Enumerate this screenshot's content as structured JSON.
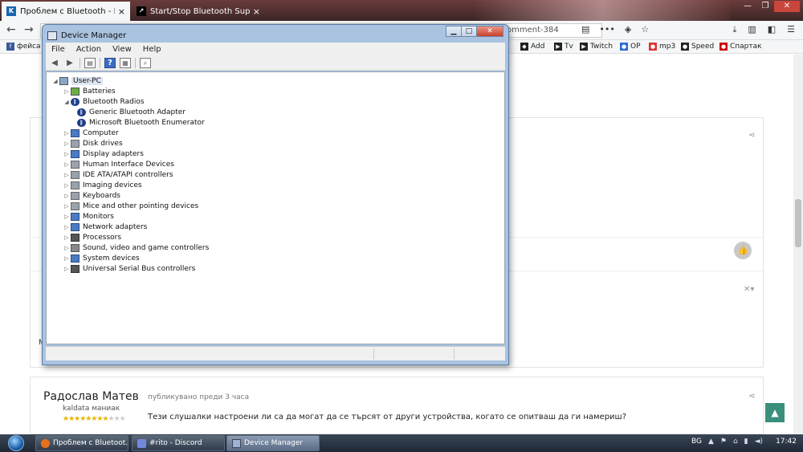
{
  "browser": {
    "tabs": [
      {
        "title": "Проблем с Bluetooth - Програ",
        "favicon": "K",
        "active": true
      },
      {
        "title": "Start/Stop Bluetooth Support se",
        "favicon": "↗",
        "active": false
      }
    ],
    "url_suffix": "omment-384",
    "bookmarks": [
      {
        "label": "фейса",
        "icon": "f",
        "color": "#3b5998"
      },
      {
        "label": "Add",
        "icon": "◆",
        "color": "#222"
      },
      {
        "label": "Tv",
        "icon": "▶",
        "color": "#222"
      },
      {
        "label": "Twitch",
        "icon": "▶",
        "color": "#222"
      },
      {
        "label": "OP",
        "icon": "●",
        "color": "#2b6cd3"
      },
      {
        "label": "mp3",
        "icon": "●",
        "color": "#d33"
      },
      {
        "label": "Speed",
        "icon": "●",
        "color": "#222"
      },
      {
        "label": "Спартак",
        "icon": "●",
        "color": "#c00"
      }
    ]
  },
  "page": {
    "left_letter": "M",
    "post": {
      "author": "Радослав Матев",
      "meta": "публикувано преди 3 часа",
      "rank": "kaldata маниак",
      "stars_filled": "★★★★★★★★",
      "stars_empty": "★★★",
      "text": "Тези слушалки настроени ли са да могат да се търсят от други устройства, когато се опитваш да ги намериш?"
    }
  },
  "device_manager": {
    "title": "Device Manager",
    "menu": [
      "File",
      "Action",
      "View",
      "Help"
    ],
    "root": "User-PC",
    "categories": [
      {
        "label": "Batteries",
        "icon": "bat",
        "expanded": false
      },
      {
        "label": "Bluetooth Radios",
        "icon": "bt",
        "expanded": true
      },
      {
        "label": "Generic Bluetooth Adapter",
        "icon": "bt",
        "child": true
      },
      {
        "label": "Microsoft Bluetooth Enumerator",
        "icon": "bt",
        "child": true
      },
      {
        "label": "Computer",
        "icon": "mon",
        "expanded": false
      },
      {
        "label": "Disk drives",
        "icon": "gen",
        "expanded": false
      },
      {
        "label": "Display adapters",
        "icon": "mon",
        "expanded": false
      },
      {
        "label": "Human Interface Devices",
        "icon": "gen",
        "expanded": false
      },
      {
        "label": "IDE ATA/ATAPI controllers",
        "icon": "gen",
        "expanded": false
      },
      {
        "label": "Imaging devices",
        "icon": "gen",
        "expanded": false
      },
      {
        "label": "Keyboards",
        "icon": "gen",
        "expanded": false
      },
      {
        "label": "Mice and other pointing devices",
        "icon": "gen",
        "expanded": false
      },
      {
        "label": "Monitors",
        "icon": "mon",
        "expanded": false
      },
      {
        "label": "Network adapters",
        "icon": "mon",
        "expanded": false
      },
      {
        "label": "Processors",
        "icon": "usb",
        "expanded": false
      },
      {
        "label": "Sound, video and game controllers",
        "icon": "snd",
        "expanded": false
      },
      {
        "label": "System devices",
        "icon": "mon",
        "expanded": false
      },
      {
        "label": "Universal Serial Bus controllers",
        "icon": "usb",
        "expanded": false
      }
    ]
  },
  "taskbar": {
    "buttons": [
      {
        "label": "Проблем с Bluetoot...",
        "icon_color": "#e8701a"
      },
      {
        "label": "#rito - Discord",
        "icon_color": "#7289da"
      },
      {
        "label": "Device Manager",
        "icon_color": "#9bb3d4",
        "active": true
      }
    ],
    "language": "BG",
    "time": "17:42"
  }
}
